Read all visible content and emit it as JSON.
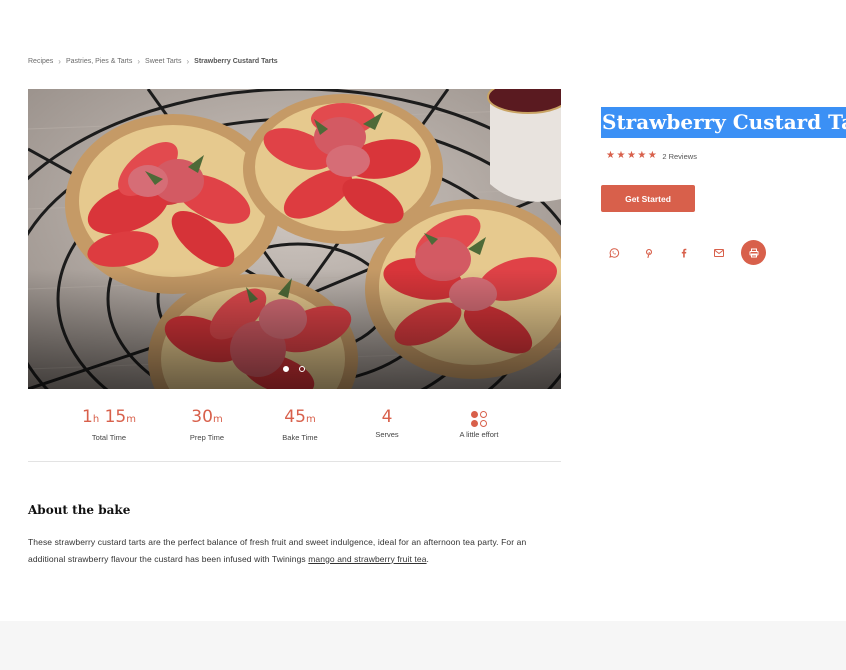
{
  "breadcrumb": {
    "items": [
      "Recipes",
      "Pastries, Pies & Tarts",
      "Sweet Tarts"
    ],
    "current": "Strawberry Custard Tarts",
    "separator": "›"
  },
  "recipe": {
    "title": "Strawberry Custard Tarts",
    "rating": {
      "stars": 5,
      "reviews_label": "2 Reviews"
    },
    "cta_label": "Get Started"
  },
  "share": {
    "icons": [
      "whatsapp-icon",
      "pinterest-icon",
      "facebook-icon",
      "email-icon",
      "print-icon"
    ]
  },
  "gallery": {
    "slides": 2,
    "active_slide": 1
  },
  "stats": {
    "total_time": {
      "hours": "1",
      "h_unit": "h",
      "minutes": "15",
      "m_unit": "m",
      "label": "Total Time"
    },
    "prep_time": {
      "value": "30",
      "unit": "m",
      "label": "Prep Time"
    },
    "bake_time": {
      "value": "45",
      "unit": "m",
      "label": "Bake Time"
    },
    "serves": {
      "value": "4",
      "label": "Serves"
    },
    "effort": {
      "label": "A little effort",
      "level": 2,
      "max": 4
    }
  },
  "about": {
    "heading": "About the bake",
    "text": "These strawberry custard tarts are the perfect balance of fresh fruit and sweet indulgence, ideal for an afternoon tea party. For an additional strawberry flavour the custard has been infused with Twinings ",
    "link_text": "mango and strawberry fruit tea",
    "text_end": "."
  },
  "colors": {
    "accent": "#d8604b",
    "selection": "#3b90f5"
  }
}
